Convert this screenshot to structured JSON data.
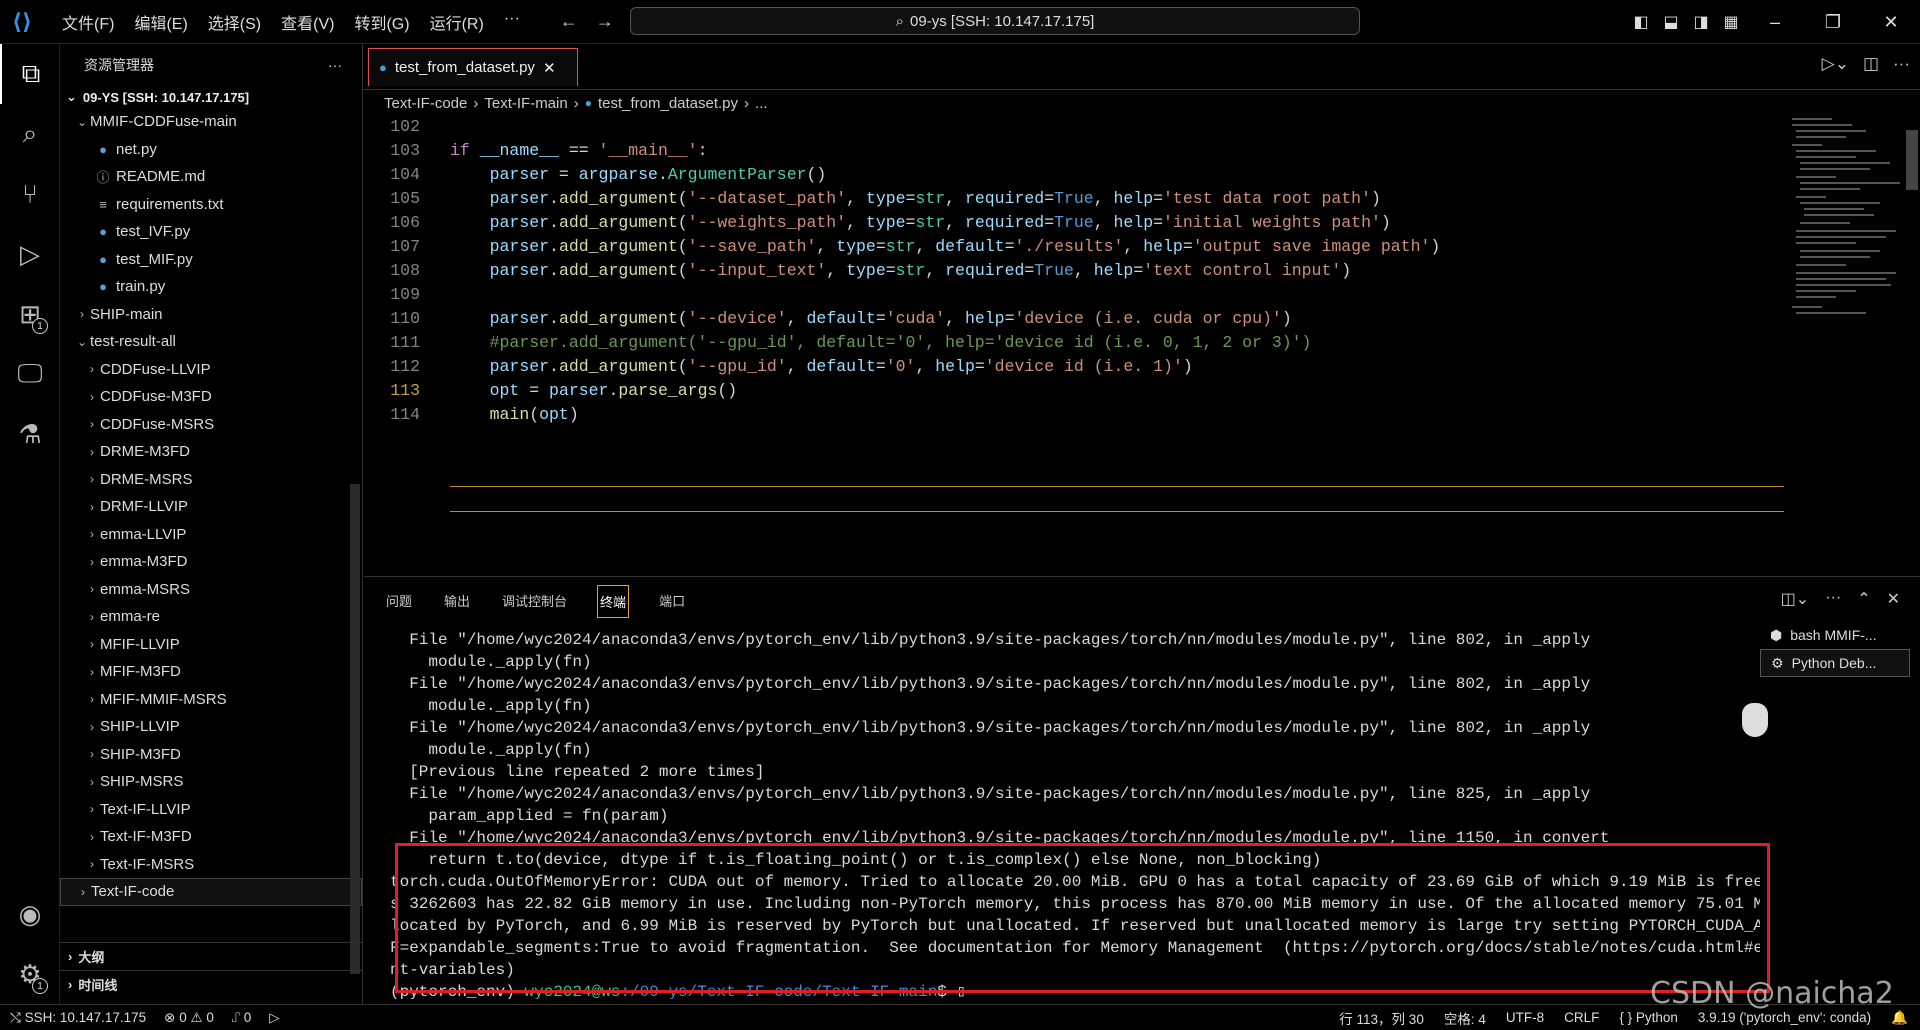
{
  "titlebar": {
    "menu": [
      "文件(F)",
      "编辑(E)",
      "选择(S)",
      "查看(V)",
      "转到(G)",
      "运行(R)",
      "···"
    ],
    "command_center": "09-ys [SSH: 10.147.17.175]",
    "window": {
      "minimize": "–",
      "restore": "❐",
      "close": "✕"
    }
  },
  "activitybar": {
    "items": [
      "explorer",
      "search",
      "source-control",
      "run-debug",
      "extensions",
      "remote-explorer",
      "testing"
    ],
    "extensions_badge": "1",
    "settings_badge": "1"
  },
  "sidebar": {
    "title": "资源管理器",
    "more": "···",
    "root": "09-YS [SSH: 10.147.17.175]",
    "project": "MMIF-CDDFuse-main",
    "files": [
      {
        "name": "net.py",
        "icon": "python"
      },
      {
        "name": "README.md",
        "icon": "info"
      },
      {
        "name": "requirements.txt",
        "icon": "text"
      },
      {
        "name": "test_IVF.py",
        "icon": "python"
      },
      {
        "name": "test_MIF.py",
        "icon": "python"
      },
      {
        "name": "train.py",
        "icon": "python"
      }
    ],
    "folders_top": [
      "SHIP-main",
      "test-result-all"
    ],
    "result_folders": [
      "CDDFuse-LLVIP",
      "CDDFuse-M3FD",
      "CDDFuse-MSRS",
      "DRME-M3FD",
      "DRME-MSRS",
      "DRMF-LLVIP",
      "emma-LLVIP",
      "emma-M3FD",
      "emma-MSRS",
      "emma-re",
      "MFIF-LLVIP",
      "MFIF-M3FD",
      "MFIF-MMIF-MSRS",
      "SHIP-LLVIP",
      "SHIP-M3FD",
      "SHIP-MSRS",
      "Text-IF-LLVIP",
      "Text-IF-M3FD",
      "Text-IF-MSRS"
    ],
    "selected_folder": "Text-IF-code",
    "outline": "大纲",
    "timeline": "时间线"
  },
  "editor": {
    "tab": "test_from_dataset.py",
    "tab_close": "✕",
    "breadcrumb": [
      "Text-IF-code",
      "Text-IF-main",
      "test_from_dataset.py",
      "..."
    ],
    "lines": [
      "102",
      "103",
      "104",
      "105",
      "106",
      "107",
      "108",
      "109",
      "110",
      "111",
      "112",
      "113",
      "114"
    ]
  },
  "panel": {
    "tabs": [
      "问题",
      "输出",
      "调试控制台",
      "终端",
      "端口"
    ],
    "active_tab": "终端",
    "terminals": [
      "bash MMIF-...",
      "Python Deb..."
    ],
    "lines": [
      "  File \"/home/wyc2024/anaconda3/envs/pytorch_env/lib/python3.9/site-packages/torch/nn/modules/module.py\", line 802, in _apply",
      "    module._apply(fn)",
      "  File \"/home/wyc2024/anaconda3/envs/pytorch_env/lib/python3.9/site-packages/torch/nn/modules/module.py\", line 802, in _apply",
      "    module._apply(fn)",
      "  File \"/home/wyc2024/anaconda3/envs/pytorch_env/lib/python3.9/site-packages/torch/nn/modules/module.py\", line 802, in _apply",
      "    module._apply(fn)",
      "  [Previous line repeated 2 more times]",
      "  File \"/home/wyc2024/anaconda3/envs/pytorch_env/lib/python3.9/site-packages/torch/nn/modules/module.py\", line 825, in _apply",
      "    param_applied = fn(param)",
      "  File \"/home/wyc2024/anaconda3/envs/pytorch_env/lib/python3.9/site-packages/torch/nn/modules/module.py\", line 1150, in convert",
      "    return t.to(device, dtype if t.is_floating_point() or t.is_complex() else None, non_blocking)",
      "torch.cuda.OutOfMemoryError: CUDA out of memory. Tried to allocate 20.00 MiB. GPU 0 has a total capacity of 23.69 GiB of which 9.19 MiB is free. Proces",
      "s 3262603 has 22.82 GiB memory in use. Including non-PyTorch memory, this process has 870.00 MiB memory in use. Of the allocated memory 75.01 MiB is al",
      "located by PyTorch, and 6.99 MiB is reserved by PyTorch but unallocated. If reserved but unallocated memory is large try setting PYTORCH_CUDA_ALLOC_CON",
      "F=expandable_segments:True to avoid fragmentation.  See documentation for Memory Management  (https://pytorch.org/docs/stable/notes/cuda.html#environme",
      "nt-variables)"
    ],
    "prompt_env": "(pytorch_env) ",
    "prompt_user": "wyc2024@ws",
    "prompt_path": ":/09-ys/Text-IF-code/Text-IF-main",
    "prompt_end": "$ "
  },
  "statusbar": {
    "remote": "SSH: 10.147.17.175",
    "errors": "⊗ 0 ⚠ 0",
    "ports": "⑀ 0",
    "position": "行 113，列 30",
    "spaces": "空格: 4",
    "encoding": "UTF-8",
    "eol": "CRLF",
    "language": "{ } Python",
    "interpreter": "3.9.19 ('pytorch_env': conda)"
  },
  "watermark": "CSDN @naicha2"
}
